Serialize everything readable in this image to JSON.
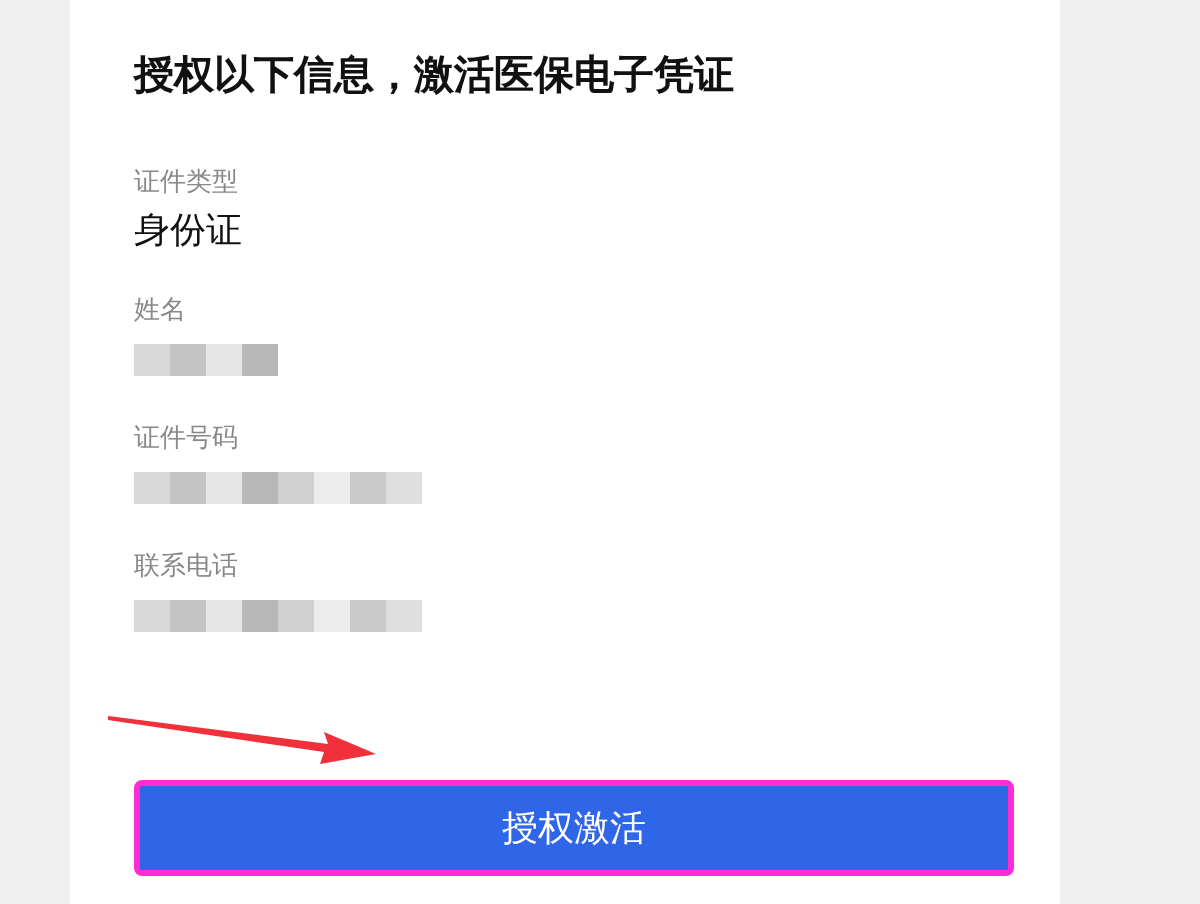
{
  "title": "授权以下信息，激活医保电子凭证",
  "fields": [
    {
      "label": "证件类型",
      "kind": "text",
      "value": "身份证"
    },
    {
      "label": "姓名",
      "kind": "redacted"
    },
    {
      "label": "证件号码",
      "kind": "redacted"
    },
    {
      "label": "联系电话",
      "kind": "redacted"
    }
  ],
  "button": {
    "label": "授权激活",
    "highlighted": true
  }
}
